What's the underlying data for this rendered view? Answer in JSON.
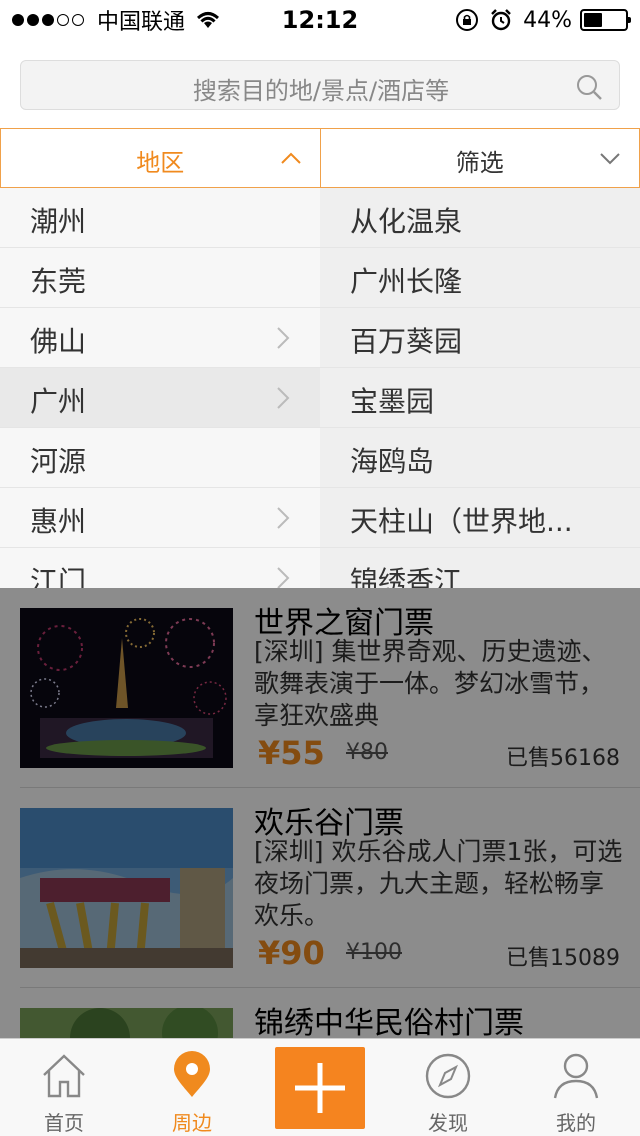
{
  "status_bar": {
    "carrier": "中国联通",
    "time": "12:12",
    "battery": "44%",
    "battery_level": 0.44
  },
  "search": {
    "placeholder": "搜索目的地/景点/酒店等"
  },
  "filters": {
    "region_label": "地区",
    "filter_label": "筛选"
  },
  "regions": [
    {
      "label": "潮州",
      "has_children": false
    },
    {
      "label": "东莞",
      "has_children": false
    },
    {
      "label": "佛山",
      "has_children": true
    },
    {
      "label": "广州",
      "has_children": true,
      "selected": true
    },
    {
      "label": "河源",
      "has_children": false
    },
    {
      "label": "惠州",
      "has_children": true
    },
    {
      "label": "江门",
      "has_children": true
    }
  ],
  "spots": [
    {
      "label": "从化温泉"
    },
    {
      "label": "广州长隆"
    },
    {
      "label": "百万葵园"
    },
    {
      "label": "宝墨园"
    },
    {
      "label": "海鸥岛"
    },
    {
      "label": "天柱山（世界地..."
    },
    {
      "label": "锦绣香江"
    }
  ],
  "products": [
    {
      "name": "世界之窗门票",
      "desc": "[深圳] 集世界奇观、历史遗迹、歌舞表演于一体。梦幻冰雪节，享狂欢盛典",
      "price": "¥55",
      "original": "¥80",
      "sold": "已售56168"
    },
    {
      "name": "欢乐谷门票",
      "desc": "[深圳] 欢乐谷成人门票1张，可选夜场门票，九大主题，轻松畅享欢乐。",
      "price": "¥90",
      "original": "¥100",
      "sold": "已售15089"
    },
    {
      "name": "锦绣中华民俗村门票",
      "desc": "",
      "price": "",
      "original": "",
      "sold": ""
    }
  ],
  "tabbar": {
    "home": "首页",
    "nearby": "周边",
    "discover": "发现",
    "mine": "我的"
  },
  "colors": {
    "accent": "#f08a1e",
    "plus_button": "#f5841f",
    "border_active": "#f0a14a"
  }
}
